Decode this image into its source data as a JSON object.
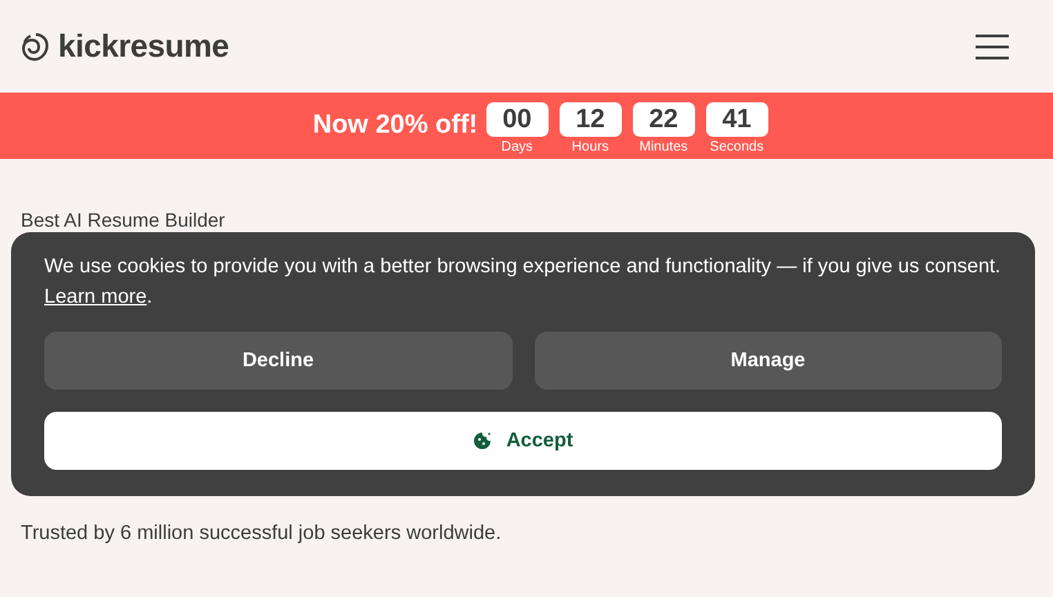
{
  "header": {
    "logo": "kickresume"
  },
  "promo": {
    "text": "Now 20% off!",
    "countdown": [
      {
        "value": "00",
        "unit": "Days"
      },
      {
        "value": "12",
        "unit": "Hours"
      },
      {
        "value": "22",
        "unit": "Minutes"
      },
      {
        "value": "41",
        "unit": "Seconds"
      }
    ]
  },
  "page": {
    "eyebrow": "Best AI Resume Builder",
    "trust_line": "Trusted by 6 million successful job seekers worldwide."
  },
  "cookie_banner": {
    "message": "We use cookies to provide you with a better browsing experience and functionality — if you give us consent.",
    "link": "Learn more",
    "link_end": ".",
    "buttons": [
      {
        "label": "Decline",
        "kind": "secondary"
      },
      {
        "label": "Manage",
        "kind": "secondary"
      },
      {
        "label": "Accept",
        "kind": "primary"
      }
    ]
  }
}
